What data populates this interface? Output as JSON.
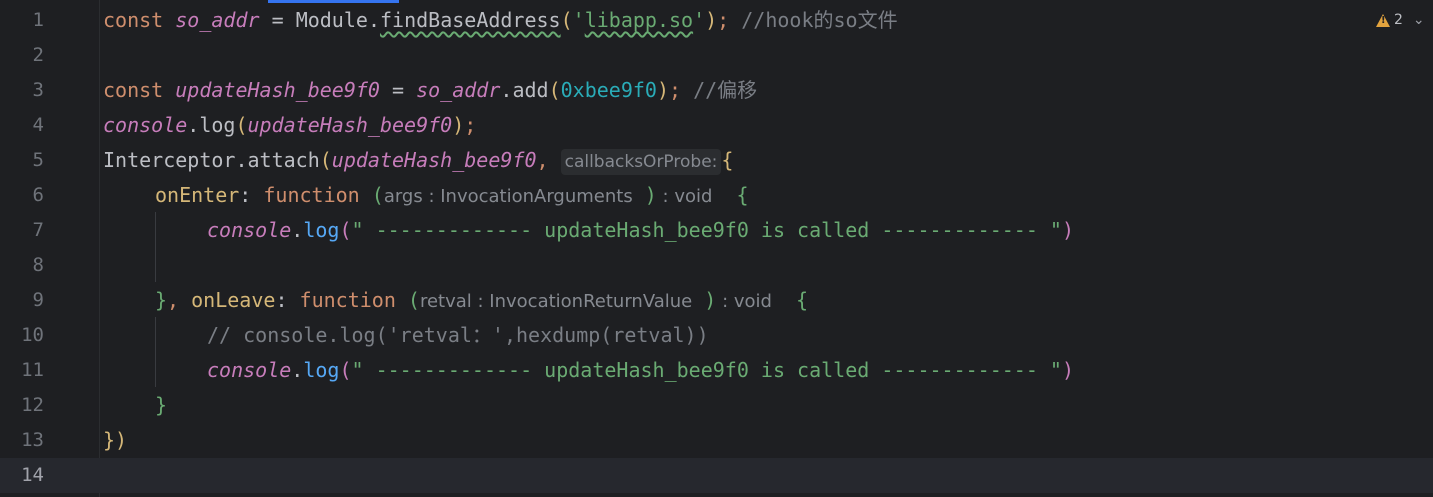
{
  "editor": {
    "problems": {
      "warning_count": "2",
      "expand_glyph": "⌄"
    },
    "lines": [
      {
        "n": "1"
      },
      {
        "n": "2"
      },
      {
        "n": "3"
      },
      {
        "n": "4"
      },
      {
        "n": "5"
      },
      {
        "n": "6"
      },
      {
        "n": "7"
      },
      {
        "n": "8"
      },
      {
        "n": "9"
      },
      {
        "n": "10"
      },
      {
        "n": "11"
      },
      {
        "n": "12"
      },
      {
        "n": "13"
      },
      {
        "n": "14"
      }
    ]
  },
  "code": {
    "l1": {
      "kw": "const",
      "var": "so_addr",
      "eq": " = ",
      "obj": "Module",
      "dot": ".",
      "method": "findBaseAddress",
      "open": "(",
      "q1": "'",
      "str": "libapp.so",
      "q2": "'",
      "close": ")",
      "semi": "; ",
      "comment": "//hook的so文件"
    },
    "l3": {
      "kw": "const",
      "var": "updateHash_bee9f0",
      "eq": " = ",
      "obj": "so_addr",
      "dot": ".",
      "method": "add",
      "open": "(",
      "num": "0xbee9f0",
      "close": ")",
      "semi": "; ",
      "comment": "//偏移"
    },
    "l4": {
      "obj": "console",
      "dot": ".",
      "method": "log",
      "open": "(",
      "arg": "updateHash_bee9f0",
      "close": ")",
      "semi": ";"
    },
    "l5": {
      "obj": "Interceptor",
      "dot": ".",
      "method": "attach",
      "open": "(",
      "arg": "updateHash_bee9f0",
      "comma": ", ",
      "hint": "callbacksOrProbe:",
      "brace": "{"
    },
    "l6": {
      "prop": "onEnter",
      "colon": ": ",
      "kw": "function",
      "open": "(",
      "param": "args",
      "type_sep": " : ",
      "type": "InvocationArguments",
      "close": ")",
      "ret_sep": " : ",
      "ret": "void",
      "brace": "{"
    },
    "l7": {
      "obj": "console",
      "dot": ".",
      "method": "log",
      "open": "(",
      "str": "\" ------------- updateHash_bee9f0 is called ------------- \"",
      "close": ")"
    },
    "l9": {
      "brace_close": "}",
      "comma": ", ",
      "prop": "onLeave",
      "colon": ": ",
      "kw": "function",
      "open": "(",
      "param": "retval",
      "type_sep": " : ",
      "type": "InvocationReturnValue",
      "close": ")",
      "ret_sep": " : ",
      "ret": "void",
      "brace": "{"
    },
    "l10": {
      "comment": "// console.log('retval：',hexdump(retval))"
    },
    "l11": {
      "obj": "console",
      "dot": ".",
      "method": "log",
      "open": "(",
      "str": "\" ------------- updateHash_bee9f0 is called ------------- \"",
      "close": ")"
    },
    "l12": {
      "brace_close": "}"
    },
    "l13": {
      "close": "})"
    }
  }
}
